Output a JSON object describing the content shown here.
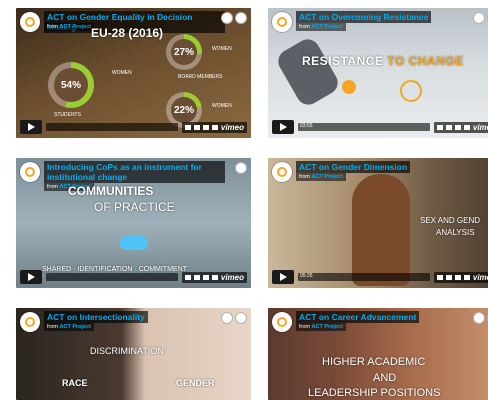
{
  "videos": [
    {
      "title": "ACT on Gender Equality in Decision Making",
      "from_prefix": "from",
      "from_link": "ACT Project",
      "time": "",
      "overlay": {
        "headline": "EU-28 (2016)",
        "students_pct": "54%",
        "students_label": "STUDENTS",
        "women_label_1": "WOMEN",
        "women_pct_1": "27%",
        "board_label": "BOARD MEMBERS",
        "women_label_2": "WOMEN",
        "women_pct_2": "22%",
        "women_label_small": "WOMEN"
      }
    },
    {
      "title": "ACT on Overcoming Resistance",
      "from_prefix": "from",
      "from_link": "ACT Project",
      "time": "03:55",
      "overlay": {
        "text_a": "RESISTANCE",
        "text_b": "TO CHANGE"
      }
    },
    {
      "title": "Introducing CoPs as an instrument for institutional change",
      "from_prefix": "from",
      "from_link": "ACT Project",
      "time": "",
      "overlay": {
        "line1": "COMMUNITIES",
        "line2": "OF PRACTICE",
        "bottom": "SHARED · IDENTIFICATION · COMMITMENT"
      }
    },
    {
      "title": "ACT on Gender Dimension",
      "from_prefix": "from",
      "from_link": "ACT Project",
      "time": "05:26",
      "overlay": {
        "line1": "SEX AND GEND",
        "line2": "ANALYSIS"
      }
    },
    {
      "title": "ACT on Intersectionality",
      "from_prefix": "from",
      "from_link": "ACT Project",
      "time": "",
      "overlay": {
        "center": "DISCRIMINATION",
        "left": "RACE",
        "right": "GENDER"
      }
    },
    {
      "title": "ACT on Career Advancement",
      "from_prefix": "from",
      "from_link": "ACT Project",
      "time": "",
      "overlay": {
        "line1": "HIGHER ACADEMIC",
        "line2": "AND",
        "line3": "LEADERSHIP POSITIONS"
      }
    }
  ],
  "player": {
    "vimeo_label": "vimeo",
    "accent_color": "#00adef"
  }
}
